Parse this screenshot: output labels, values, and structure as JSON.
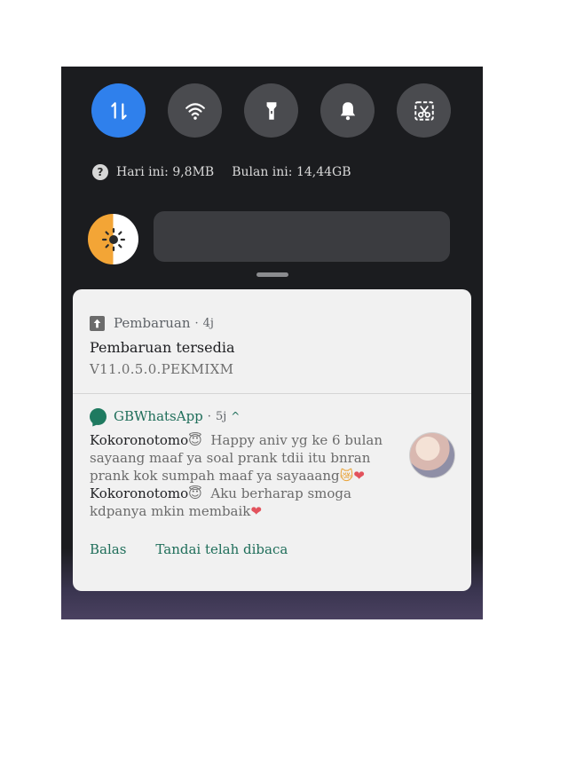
{
  "quick_settings": {
    "tiles": [
      {
        "name": "data-toggle",
        "icon": "mobile-data-icon",
        "active": true
      },
      {
        "name": "wifi",
        "icon": "wifi-icon",
        "active": false
      },
      {
        "name": "flashlight",
        "icon": "flashlight-icon",
        "active": false
      },
      {
        "name": "sound",
        "icon": "bell-icon",
        "active": false
      },
      {
        "name": "screenshot",
        "icon": "scissors-screenshot-icon",
        "active": false
      }
    ],
    "accent_color": "#2f80ec"
  },
  "usage": {
    "help_icon": "?",
    "today": "Hari ini: 9,8MB",
    "month": "Bulan ini: 14,44GB"
  },
  "brightness": {
    "icon": "brightness-icon",
    "level": 0.0
  },
  "notifications": {
    "update": {
      "app_name": "Pembaruan",
      "time": "4j",
      "title": "Pembaruan tersedia",
      "text": "V11.0.5.0.PEKMIXM"
    },
    "whatsapp": {
      "app_name": "GBWhatsApp",
      "time": "5j",
      "messages": [
        {
          "sender": "Kokoronotomo",
          "sender_emoji": "😇",
          "text": "Happy aniv yg ke 6 bulan sayaang maaf ya soal prank tdii itu bnran prank kok sumpah maaf ya sayaaang",
          "end_emoji_1": "😿",
          "end_emoji_2": "❤"
        },
        {
          "sender": "Kokoronotomo",
          "sender_emoji": "😇",
          "text": "Aku berharap smoga kdpanya mkin membaik",
          "end_emoji_1": "❤"
        }
      ],
      "actions": {
        "reply": "Balas",
        "mark_read": "Tandai telah dibaca"
      },
      "brand_color": "#1f6e5a"
    }
  }
}
